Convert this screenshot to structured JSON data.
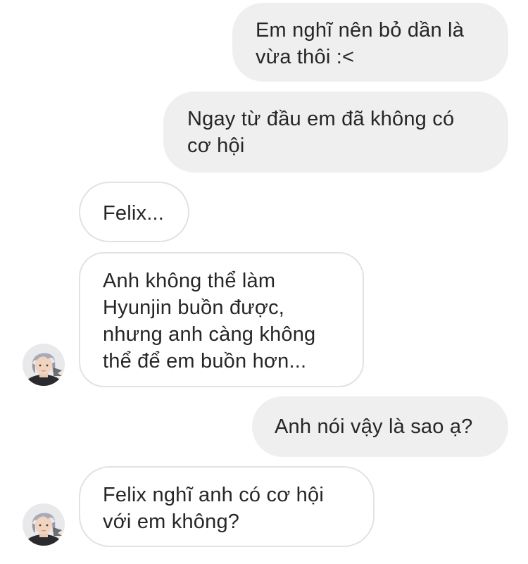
{
  "messages": [
    {
      "direction": "outgoing",
      "text": "Em nghĩ nên bỏ dần là\nvừa thôi :<"
    },
    {
      "direction": "outgoing",
      "text": "Ngay từ đầu em đã không có\ncơ hội"
    },
    {
      "direction": "incoming",
      "text": "Felix..."
    },
    {
      "direction": "incoming",
      "text": " Anh không thể làm\nHyunjin buồn được,\nnhưng anh càng không\nthể để em buồn hơn..."
    },
    {
      "direction": "outgoing",
      "text": "Anh nói vậy là sao ạ?"
    },
    {
      "direction": "incoming",
      "text": " Felix nghĩ anh có cơ hội\nvới em không?"
    }
  ],
  "colors": {
    "outgoing_bubble": "#efefef",
    "incoming_border": "#e2e2e2",
    "text": "#262626",
    "background": "#ffffff"
  },
  "icons": {
    "avatar": "contact-avatar-photo"
  }
}
